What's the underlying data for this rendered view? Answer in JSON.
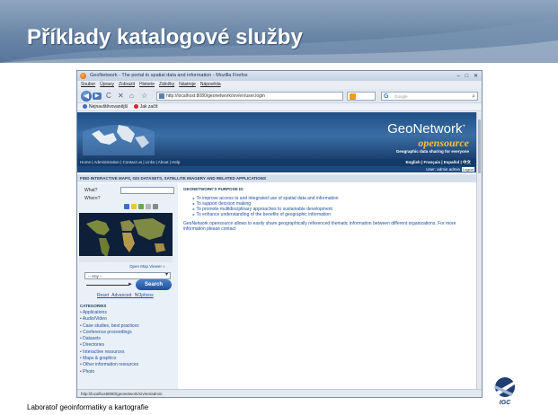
{
  "slide": {
    "title": "Příklady katalogové služby",
    "footer": "Laboratoř geoinformatiky a kartografie",
    "logo_text": "IGC",
    "accent_color": "#6b86a6"
  },
  "browser": {
    "window_title": "GeoNetwork - The portal to spatial data and information - Mozilla Firefox",
    "menu": [
      "Soubor",
      "Úpravy",
      "Zobrazit",
      "Historie",
      "Záložky",
      "Nástroje",
      "Nápověda"
    ],
    "url": "http://localhost:8080/geonetwork/srv/en/user.login",
    "search_placeholder": "Google",
    "bookmarks": [
      "Nejnavštěvovanější",
      "Jak začít"
    ],
    "status_url": "http://localhost8080/geonetwork/srv/en/admin"
  },
  "site": {
    "logo": "GeoNetwork",
    "logo_sub": "opensource",
    "tagline": "Geographic data sharing for everyone",
    "nav": "Home | Administration | Contact us | Links | About | Help",
    "languages": "English | Français | Español | 中文",
    "user": "User: admin admin",
    "logout": "Logout",
    "find_bar": "FIND INTERACTIVE MAPS, GIS DATASETS, SATELLITE IMAGERY AND RELATED APPLICATIONS",
    "what_label": "What?",
    "where_label": "Where?",
    "open_map_viewer": "Open Map Viewer »",
    "any_option": "-- Any --",
    "search_button": "Search",
    "search_links": "Reset  Advanced  NOptions",
    "categories_header": "CATEGORIES",
    "categories": [
      "Applications",
      "Audio/Video",
      "Case studies, best practices",
      "Conference proceedings",
      "Datasets",
      "Directories",
      "Interactive resources",
      "Maps & graphics",
      "Other information resources",
      "Photo"
    ],
    "purpose_header": "GEONETWORK'S PURPOSE IS:",
    "purpose_items": [
      "To improve access to and integrated use of spatial data and information",
      "To support decision making",
      "To promote multidisciplinary approaches to sustainable development",
      "To enhance understanding of the benefits of geographic information"
    ],
    "purpose_text": "GeoNetwork opensource allows to easily share geographically referenced thematic information between different organizations. For more information please contact"
  }
}
